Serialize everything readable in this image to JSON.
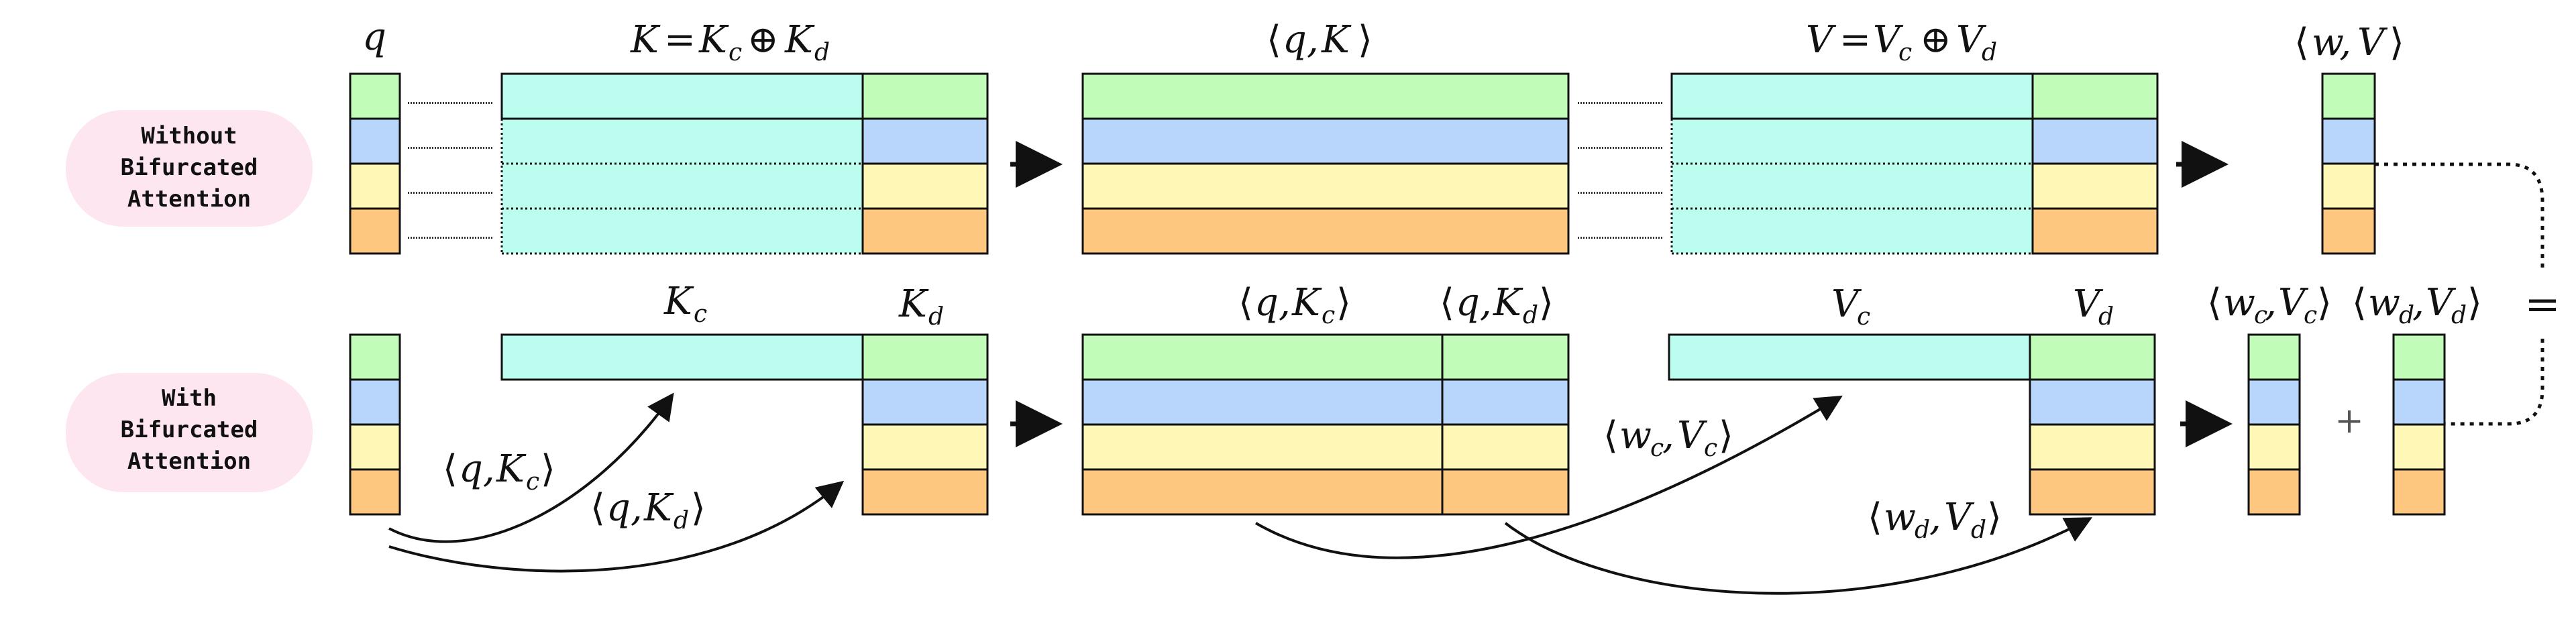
{
  "colors": {
    "row1": "#c1fcb8",
    "row2": "#b8d5fc",
    "row3": "#fff7b5",
    "row4": "#fec77f",
    "cache": "#bbfef0",
    "pill": "#fde6f0",
    "line": "#111111"
  },
  "rows": [
    {
      "id": "without",
      "pill_lines": [
        "Without",
        "Bifurcated",
        "Attention"
      ]
    },
    {
      "id": "with",
      "pill_lines": [
        "With",
        "Bifurcated",
        "Attention"
      ]
    }
  ],
  "labels": {
    "top": {
      "q": "q",
      "K": "K = K_c ⊕ K_d",
      "qK": "⟨q, K⟩",
      "V": "V = V_c ⊕ V_d",
      "wV": "⟨w, V⟩"
    },
    "bottom": {
      "Kc": "K_c",
      "Kd": "K_d",
      "qKc": "⟨q, K_c⟩",
      "qKd": "⟨q, K_d⟩",
      "Vc": "V_c",
      "Vd": "V_d",
      "wcVc": "⟨w_c, V_c⟩",
      "wdVd": "⟨w_d, V_d⟩",
      "arc_qKc": "⟨q, K_c⟩",
      "arc_qKd": "⟨q, K_d⟩",
      "arc_wcVc": "⟨w_c, V_c⟩",
      "arc_wdVd": "⟨w_d, V_d⟩",
      "plus": "+",
      "equals": "="
    }
  }
}
